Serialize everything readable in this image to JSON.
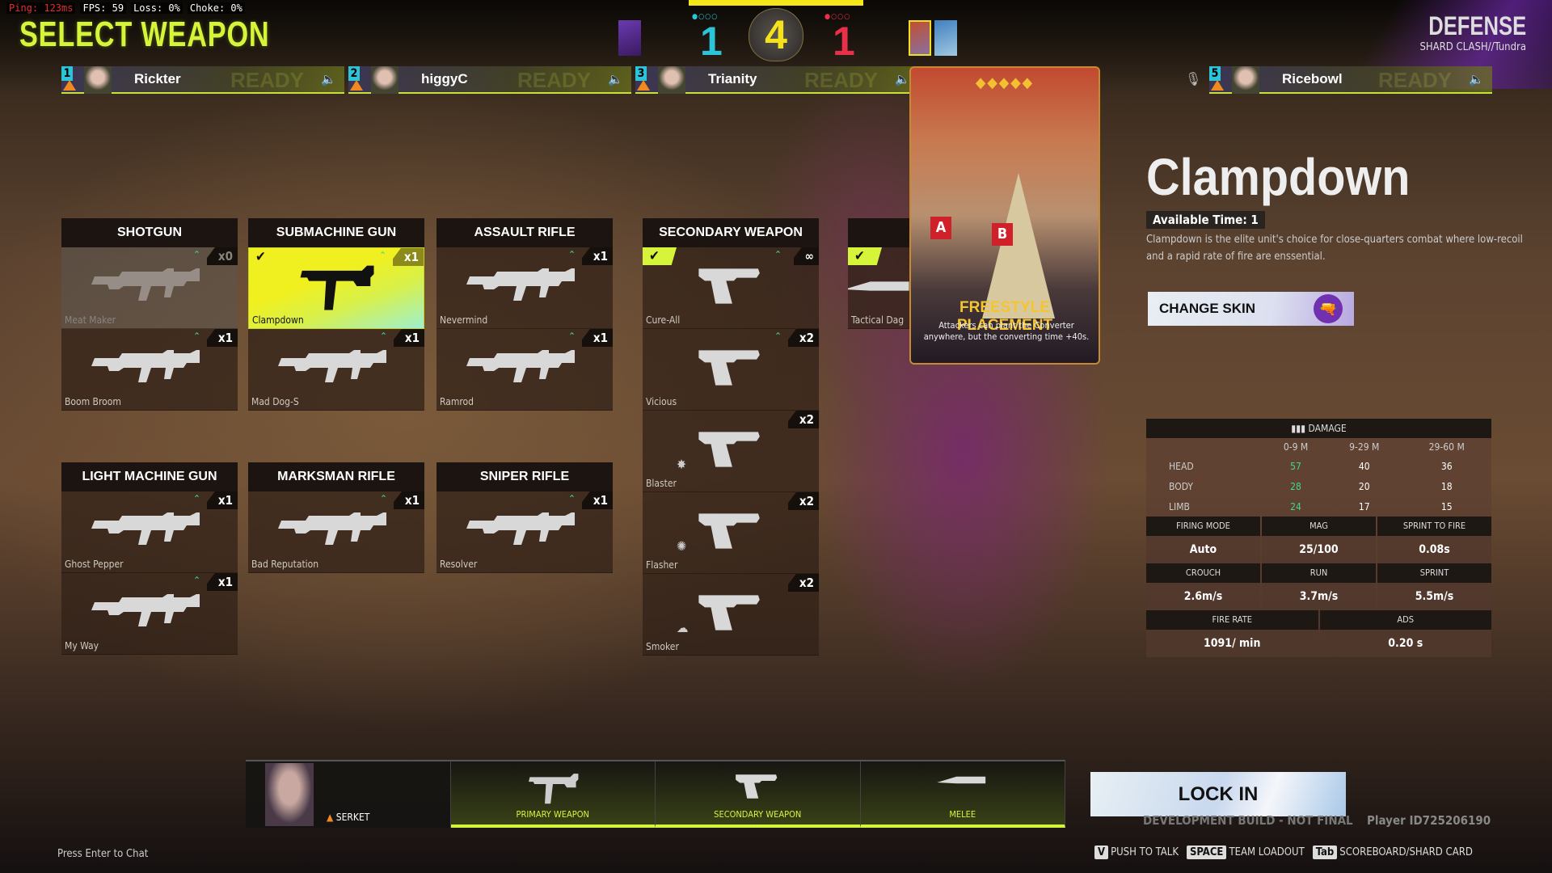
{
  "hud": {
    "ping": "Ping: 123ms",
    "fps": "FPS: 59",
    "loss": "Loss: 0%",
    "choke": "Choke: 0%"
  },
  "title": "SELECT WEAPON",
  "score": {
    "round": "4",
    "ally": "1",
    "enemy": "1",
    "ally_color": "#2bc4d8",
    "enemy_color": "#e8304a",
    "ally_dots": "●○○○",
    "enemy_dots": "●○○○"
  },
  "mode": {
    "side": "DEFENSE",
    "subtitle": "SHARD CLASH//Tundra"
  },
  "players": [
    {
      "slot": "1",
      "name": "Rickter"
    },
    {
      "slot": "2",
      "name": "higgyC"
    },
    {
      "slot": "3",
      "name": "Trianity"
    },
    {
      "slot": "5",
      "name": "Ricebowl"
    }
  ],
  "ready_watermark": "READY",
  "categories": [
    {
      "label": "SHOTGUN",
      "weapons": [
        {
          "name": "Meat Maker",
          "count": "x0",
          "disabled": true,
          "up": true,
          "icon": "rifle"
        },
        {
          "name": "Boom Broom",
          "count": "x1",
          "up": true,
          "icon": "rifle"
        }
      ]
    },
    {
      "label": "SUBMACHINE GUN",
      "weapons": [
        {
          "name": "Clampdown",
          "count": "x1",
          "selected": true,
          "up": true,
          "icon": "smg"
        },
        {
          "name": "Mad Dog-S",
          "count": "x1",
          "up": true,
          "icon": "rifle"
        }
      ]
    },
    {
      "label": "ASSAULT RIFLE",
      "weapons": [
        {
          "name": "Nevermind",
          "count": "x1",
          "up": true,
          "icon": "rifle"
        },
        {
          "name": "Ramrod",
          "count": "x1",
          "up": true,
          "icon": "rifle"
        }
      ]
    },
    {
      "label": "SECONDARY WEAPON",
      "weapons": [
        {
          "name": "Cure-All",
          "count": "∞",
          "equipped": true,
          "up": true,
          "icon": "pistol"
        },
        {
          "name": "Vicious",
          "count": "x2",
          "up": true,
          "icon": "pistol"
        },
        {
          "name": "Blaster",
          "count": "x2",
          "icon": "pistol",
          "mod": "✸"
        },
        {
          "name": "Flasher",
          "count": "x2",
          "icon": "pistol",
          "mod": "✺"
        },
        {
          "name": "Smoker",
          "count": "x2",
          "icon": "pistol",
          "mod": "☁"
        }
      ]
    },
    {
      "label": "",
      "weapons": [
        {
          "name": "Tactical Dag",
          "equipped": true,
          "icon": "knife"
        }
      ]
    },
    {
      "label": "LIGHT MACHINE GUN",
      "weapons": [
        {
          "name": "Ghost Pepper",
          "count": "x1",
          "up": true,
          "icon": "rifle"
        },
        {
          "name": "My Way",
          "count": "x1",
          "up": true,
          "icon": "rifle"
        }
      ]
    },
    {
      "label": "MARKSMAN RIFLE",
      "weapons": [
        {
          "name": "Bad Reputation",
          "count": "x1",
          "up": true,
          "icon": "rifle"
        }
      ]
    },
    {
      "label": "SNIPER RIFLE",
      "weapons": [
        {
          "name": "Resolver",
          "count": "x1",
          "up": true,
          "icon": "rifle"
        }
      ]
    }
  ],
  "shard_card": {
    "stars": "◆◆◆◆◆",
    "title": "FREESTYLE PLACEMENT",
    "description": "Attackers can plant the Converter anywhere, but the converting time +40s.",
    "flag_a": "A",
    "flag_b": "B"
  },
  "detail": {
    "name": "Clampdown",
    "available": "Available Time:  1",
    "description": "Clampdown is the elite unit's choice for close-quarters combat where low-recoil and a rapid rate of fire are enssential.",
    "change_skin": "CHANGE SKIN"
  },
  "stats": {
    "damage_label": "DAMAGE",
    "ranges": [
      "0-9 M",
      "9-29 M",
      "29-60 M"
    ],
    "rows": [
      {
        "part": "HEAD",
        "values": [
          "57",
          "40",
          "36"
        ]
      },
      {
        "part": "BODY",
        "values": [
          "28",
          "20",
          "18"
        ]
      },
      {
        "part": "LIMB",
        "values": [
          "24",
          "17",
          "15"
        ]
      }
    ],
    "firing_mode_label": "FIRING MODE",
    "firing_mode": "Auto",
    "mag_label": "MAG",
    "mag": "25/100",
    "sprint_to_fire_label": "SPRINT TO FIRE",
    "sprint_to_fire": "0.08s",
    "crouch_label": "CROUCH",
    "crouch": "2.6m/s",
    "run_label": "RUN",
    "run": "3.7m/s",
    "sprint_label": "SPRINT",
    "sprint": "5.5m/s",
    "fire_rate_label": "FIRE RATE",
    "fire_rate": "1091/ min",
    "ads_label": "ADS",
    "ads": "0.20 s"
  },
  "loadout": {
    "character": "SERKET",
    "primary": "PRIMARY WEAPON",
    "secondary": "SECONDARY WEAPON",
    "melee": "MELEE"
  },
  "lock_in": "LOCK IN",
  "dev_build": "DEVELOPMENT BUILD - NOT FINAL",
  "player_id": "Player ID725206190",
  "chat_hint": "Press Enter to Chat",
  "keys": [
    {
      "key": "V",
      "label": "PUSH TO TALK"
    },
    {
      "key": "SPACE",
      "label": "TEAM LOADOUT"
    },
    {
      "key": "Tab",
      "label": "SCOREBOARD/SHARD CARD"
    }
  ]
}
